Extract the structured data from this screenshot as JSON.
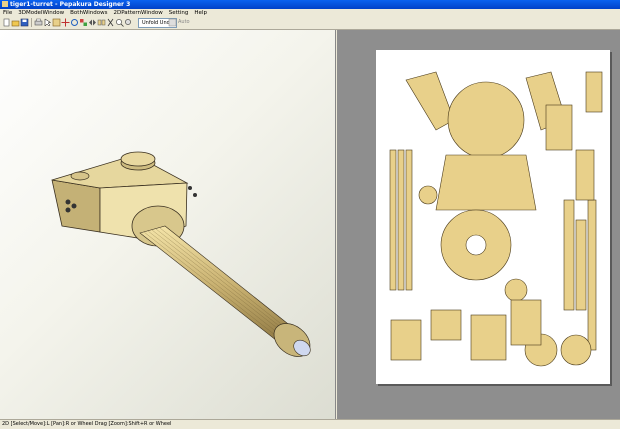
{
  "window": {
    "title": "tiger1-turret - Pepakura Designer 3"
  },
  "menu": [
    "File",
    "3DModelWindow",
    "BothWindows",
    "2DPatternWindow",
    "Setting",
    "Help"
  ],
  "toolbar": {
    "icons": [
      "new-icon",
      "open-icon",
      "save-icon",
      "print-icon",
      "cursor-icon",
      "select-icon",
      "move-icon",
      "rotate-icon",
      "texture-icon",
      "flip-icon",
      "join-icon",
      "cut-icon",
      "zoom-in-icon",
      "zoom-out-icon",
      "fit-icon",
      "layout-icon",
      "settings-icon",
      "unfold-icon"
    ],
    "unfold_label": "Unfold Undo",
    "extra_label": "Auto"
  },
  "status": {
    "text": "2D [Select/Move]:L [Pan]:R or Wheel Drag [Zoom]:Shift+R or Wheel"
  },
  "colors": {
    "part_fill": "#e8d08a",
    "part_stroke": "#4a3a1a",
    "paper": "#ffffff",
    "pattern_bg": "#8e8e8e"
  }
}
